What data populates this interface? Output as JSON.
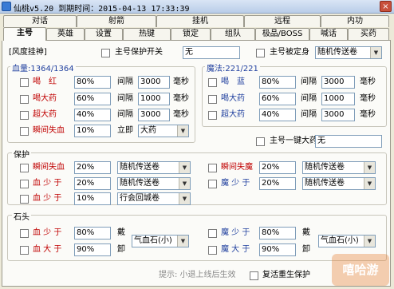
{
  "window": {
    "title": "仙桃v5.20 到期时间：2015-04-13 17:33:39",
    "close_label": "×"
  },
  "tabs_top": [
    "对话",
    "射箭",
    "挂机",
    "远程",
    "内功"
  ],
  "tabs_bottom": [
    "主号",
    "英雄",
    "设置",
    "热键",
    "锁定",
    "组队",
    "极品/BOSS",
    "喊话",
    "买药"
  ],
  "header": {
    "group_title": "[风度挂神]",
    "main_protect_label": "主号保护开关",
    "main_protect_value": "无",
    "main_locked_label": "主号被定身",
    "main_locked_value": "随机传送卷"
  },
  "hp_group": {
    "title": "血量:1364/1364",
    "rows": [
      {
        "label": "喝　红",
        "value": "80%",
        "interval_label": "间隔",
        "interval": "3000",
        "unit": "毫秒"
      },
      {
        "label": "喝大药",
        "value": "60%",
        "interval_label": "间隔",
        "interval": "1000",
        "unit": "毫秒"
      },
      {
        "label": "超大药",
        "value": "40%",
        "interval_label": "间隔",
        "interval": "3000",
        "unit": "毫秒"
      }
    ],
    "instant_row": {
      "label": "瞬间失血",
      "value": "10%",
      "action_label": "立即",
      "select": "大药"
    }
  },
  "mp_group": {
    "title": "魔法:221/221",
    "rows": [
      {
        "label": "喝　蓝",
        "value": "80%",
        "interval_label": "间隔",
        "interval": "3000",
        "unit": "毫秒"
      },
      {
        "label": "喝大药",
        "value": "60%",
        "interval_label": "间隔",
        "interval": "1000",
        "unit": "毫秒"
      },
      {
        "label": "超大药",
        "value": "40%",
        "interval_label": "间隔",
        "interval": "3000",
        "unit": "毫秒"
      }
    ]
  },
  "one_key": {
    "label": "主号一键大药",
    "value": "无"
  },
  "protect_group": {
    "title": "保护",
    "left": [
      {
        "label": "瞬间失血",
        "value": "20%",
        "select": "随机传送卷"
      },
      {
        "label": "血 少 于",
        "value": "20%",
        "select": "随机传送卷"
      },
      {
        "label": "血 少 于",
        "value": "10%",
        "select": "行会回城卷"
      }
    ],
    "right": [
      {
        "label": "瞬间失魔",
        "value": "20%",
        "select": "随机传送卷"
      },
      {
        "label": "魔 少 于",
        "value": "20%",
        "select": "随机传送卷"
      }
    ]
  },
  "stone_group": {
    "title": "石头",
    "left": [
      {
        "label": "血 少 于",
        "value": "80%",
        "action": "戴"
      },
      {
        "label": "血 大 于",
        "value": "90%",
        "action": "卸"
      }
    ],
    "left_select": "气血石(小)",
    "right": [
      {
        "label": "魔 少 于",
        "value": "80%",
        "action": "戴"
      },
      {
        "label": "魔 大 于",
        "value": "90%",
        "action": "卸"
      }
    ],
    "right_select": "气血石(小)"
  },
  "footer": {
    "hint": "提示: 小退上线后生效",
    "revive_label": "复活重生保护"
  },
  "watermark": "嘻哈游"
}
